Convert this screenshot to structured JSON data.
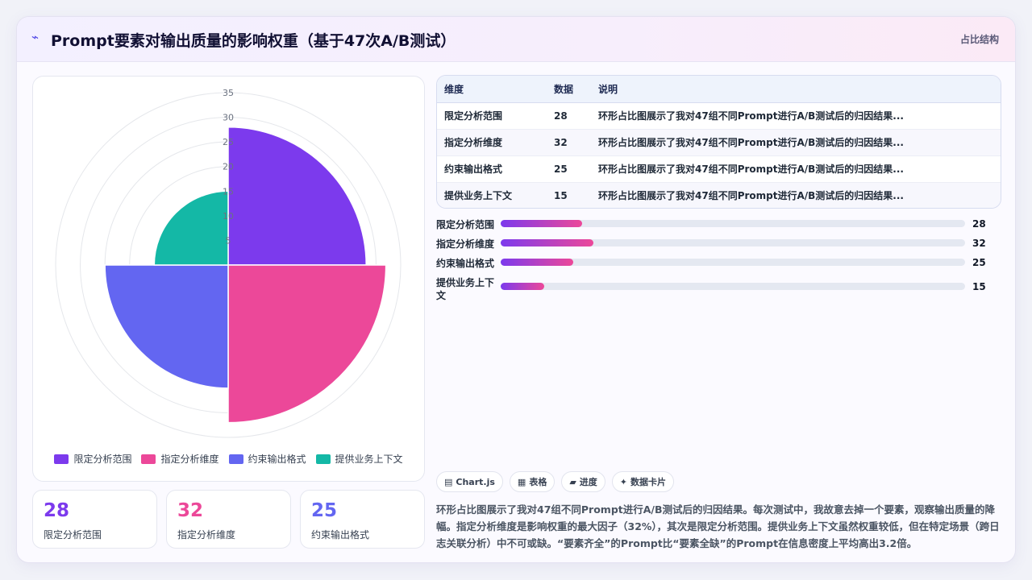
{
  "header": {
    "icon": "chart-icon",
    "title": "Prompt要素对输出质量的影响权重（基于47次A/B测试）",
    "tag": "占比结构"
  },
  "colors": {
    "accent": "#4f46e5",
    "series": [
      "#7c3aed",
      "#ec4899",
      "#6366f1",
      "#14b8a6"
    ]
  },
  "chart_data": {
    "type": "polarArea",
    "categories": [
      "限定分析范围",
      "指定分析维度",
      "约束输出格式",
      "提供业务上下文"
    ],
    "values": [
      28,
      32,
      25,
      15
    ],
    "r_range": [
      0,
      35
    ],
    "r_ticks": [
      "5",
      "10",
      "15",
      "20",
      "25",
      "30",
      "35"
    ],
    "grid": true,
    "legend": "bottom"
  },
  "table": {
    "headers": [
      "维度",
      "数据",
      "说明"
    ],
    "rows": [
      [
        "限定分析范围",
        "28",
        "环形占比图展示了我对47组不同Prompt进行A/B测试后的归因结果..."
      ],
      [
        "指定分析维度",
        "32",
        "环形占比图展示了我对47组不同Prompt进行A/B测试后的归因结果..."
      ],
      [
        "约束输出格式",
        "25",
        "环形占比图展示了我对47组不同Prompt进行A/B测试后的归因结果..."
      ],
      [
        "提供业务上下文",
        "15",
        "环形占比图展示了我对47组不同Prompt进行A/B测试后的归因结果..."
      ]
    ]
  },
  "progress": [
    {
      "label": "限定分析范围",
      "value": "28",
      "fraction": 0.175
    },
    {
      "label": "指定分析维度",
      "value": "32",
      "fraction": 0.2
    },
    {
      "label": "约束输出格式",
      "value": "25",
      "fraction": 0.156
    },
    {
      "label": "提供业务上下文",
      "value": "15",
      "fraction": 0.094
    }
  ],
  "stats": [
    {
      "value": "28",
      "label": "限定分析范围",
      "color": "#7c3aed"
    },
    {
      "value": "32",
      "label": "指定分析维度",
      "color": "#ec4899"
    },
    {
      "value": "25",
      "label": "约束输出格式",
      "color": "#6366f1"
    }
  ],
  "buttons": [
    {
      "icon": "chart-icon",
      "glyph": "▤",
      "label": "Chart.js"
    },
    {
      "icon": "table-icon",
      "glyph": "▦",
      "label": "表格"
    },
    {
      "icon": "progress-icon",
      "glyph": "▰",
      "label": "进度"
    },
    {
      "icon": "sparkle-icon",
      "glyph": "✦",
      "label": "数据卡片"
    }
  ],
  "description": "环形占比图展示了我对47组不同Prompt进行A/B测试后的归因结果。每次测试中，我故意去掉一个要素，观察输出质量的降幅。指定分析维度是影响权重的最大因子（32%），其次是限定分析范围。提供业务上下文虽然权重较低，但在特定场景（跨日志关联分析）中不可或缺。“要素齐全”的Prompt比“要素全缺”的Prompt在信息密度上平均高出3.2倍。"
}
